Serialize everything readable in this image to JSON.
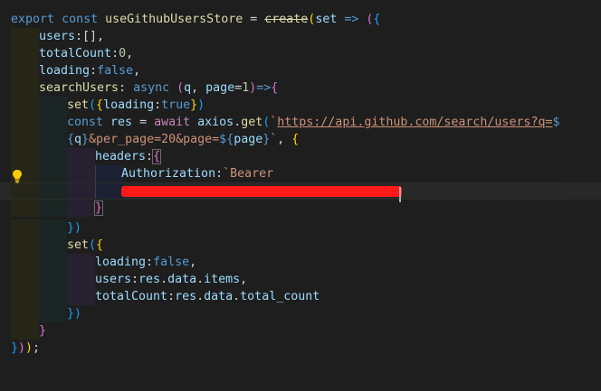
{
  "code": {
    "l1": {
      "export": "export",
      "const": "const",
      "name": "useGithubUsersStore",
      "eq": " = ",
      "create": "create",
      "open": "(",
      "set": "set",
      "arrow": " => ",
      "open2": "(",
      "open3": "{"
    },
    "l2": {
      "key": "users",
      "rest": ":[],"
    },
    "l3": {
      "key": "totalCount",
      "colon": ":",
      "val": "0",
      "comma": ","
    },
    "l4": {
      "key": "loading",
      "colon": ":",
      "val": "false",
      "comma": ","
    },
    "l5": {
      "key": "searchUsers",
      "colon": ": ",
      "async": "async",
      "sp": " ",
      "open": "(",
      "q": "q",
      "comma": ", ",
      "page": "page",
      "eq": "=",
      "one": "1",
      "close": ")",
      "arrow": "=>",
      "brace": "{"
    },
    "l6": {
      "set": "set",
      "open": "(",
      "brace": "{",
      "key": "loading",
      "colon": ":",
      "val": "true",
      "close": "}",
      "close2": ")"
    },
    "l7": {
      "const": "const",
      "res": "res",
      "eq": " = ",
      "await": "await",
      "axios": "axios",
      "dot": ".",
      "get": "get",
      "open": "(",
      "tick": "`",
      "url": "https://api.github.com/search/users?q=",
      "dollar": "$"
    },
    "l8": {
      "open": "{",
      "q": "q",
      "close": "}",
      "mid": "&per_page=20&page=",
      "dollar": "$",
      "open2": "{",
      "page": "page",
      "close2": "}",
      "tick": "`",
      "comma": ", ",
      "brace": "{"
    },
    "l9": {
      "key": "headers",
      "colon": ":",
      "brace": "{"
    },
    "l10": {
      "key": "Authorization",
      "colon": ":",
      "str": "`Bearer"
    },
    "l12": {
      "brace": "}"
    },
    "l13": {
      "text": "})"
    },
    "l14": {
      "set": "set",
      "open": "(",
      "brace": "{"
    },
    "l15": {
      "key": "loading",
      "colon": ":",
      "val": "false",
      "comma": ","
    },
    "l16": {
      "key": "users",
      "colon": ":",
      "res": "res",
      "dot1": ".",
      "data": "data",
      "dot2": ".",
      "items": "items",
      "comma": ","
    },
    "l17": {
      "key": "totalCount",
      "colon": ":",
      "res": "res",
      "dot1": ".",
      "data": "data",
      "dot2": ".",
      "tc": "total_count"
    },
    "l18": {
      "text": "})"
    },
    "l19": {
      "text": "}"
    },
    "l20": {
      "a": "}",
      "b": ")",
      "c": ")",
      "d": ";"
    }
  },
  "icons": {
    "lightbulb": "lightbulb-icon"
  },
  "colors": {
    "background": "#1e1e1e",
    "keyword": "#569cd6",
    "function": "#dcdcaa",
    "variable": "#9cdcfe",
    "string": "#ce9178",
    "number": "#b5cea8",
    "redaction": "#ff1a1a"
  }
}
